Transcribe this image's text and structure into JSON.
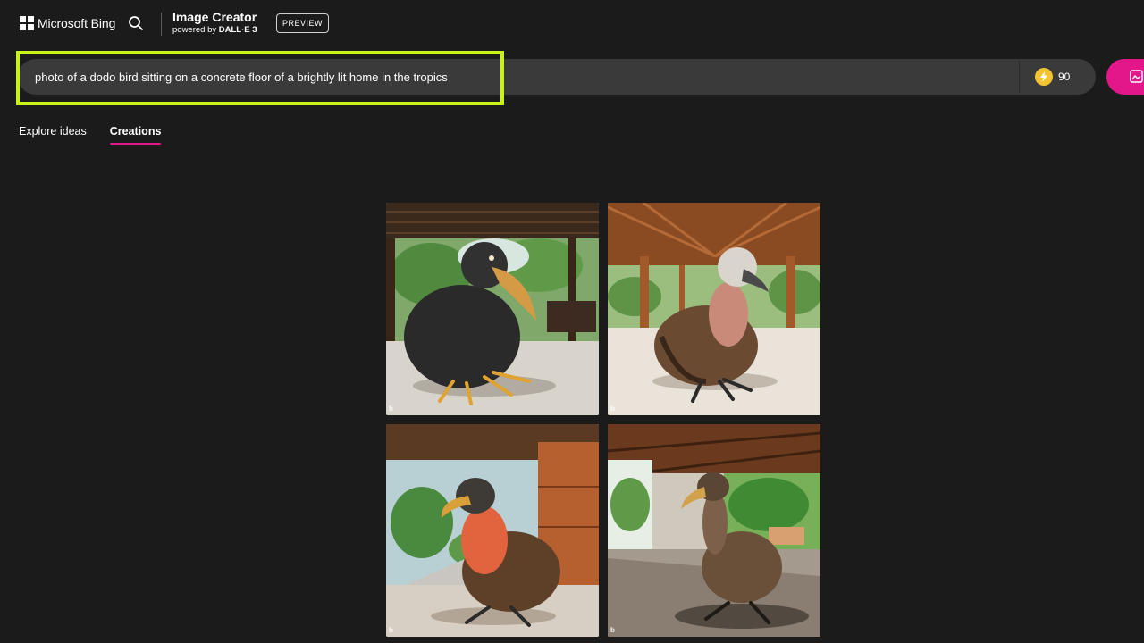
{
  "header": {
    "brand": "Microsoft Bing",
    "title": "Image Creator",
    "subtitle_prefix": "powered by ",
    "subtitle_model": "DALL·E 3",
    "badge": "PREVIEW"
  },
  "prompt": {
    "value": "photo of a dodo bird sitting on a concrete floor of a brightly lit home in the tropics",
    "boosts": "90"
  },
  "tabs": [
    {
      "label": "Explore ideas",
      "active": false
    },
    {
      "label": "Creations",
      "active": true
    }
  ],
  "images": [
    {
      "watermark": "b"
    },
    {
      "watermark": "b"
    },
    {
      "watermark": "b"
    },
    {
      "watermark": "b"
    }
  ],
  "icons": {
    "logo": "microsoft-logo-icon",
    "search": "search-icon",
    "boost": "lightning-coin-icon",
    "create": "image-create-icon"
  },
  "colors": {
    "background": "#1b1b1b",
    "accent": "#e3178a",
    "highlight": "#c9f21b",
    "boost": "#f4c430"
  }
}
